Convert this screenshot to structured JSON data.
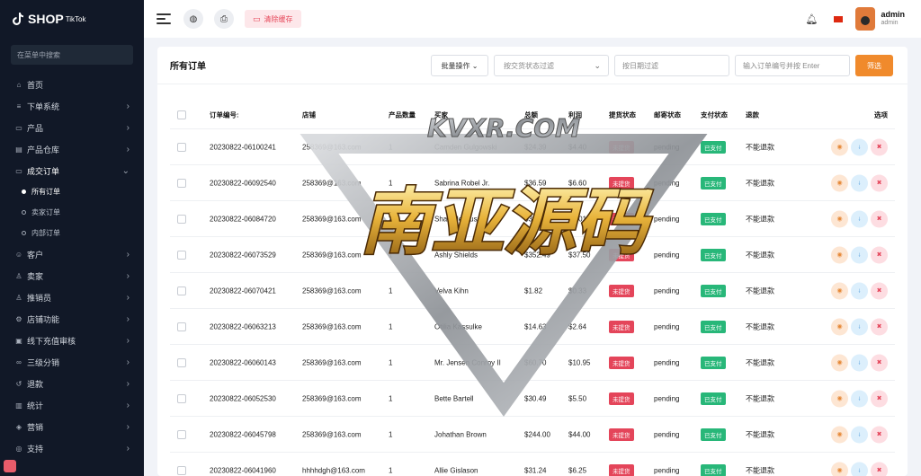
{
  "brand": {
    "name": "SHOP",
    "sub": "TikTok"
  },
  "sidebar": {
    "search_placeholder": "在菜单中搜索",
    "items": [
      {
        "label": "首页",
        "icon": "home-icon",
        "glyph": "⌂"
      },
      {
        "label": "下单系统",
        "icon": "list-icon",
        "glyph": "≡"
      },
      {
        "label": "产品",
        "icon": "bag-icon",
        "glyph": "▭"
      },
      {
        "label": "产品仓库",
        "icon": "warehouse-icon",
        "glyph": "▤"
      },
      {
        "label": "成交订单",
        "icon": "order-icon",
        "glyph": "▭"
      },
      {
        "label": "客户",
        "icon": "users-icon",
        "glyph": "☺"
      },
      {
        "label": "卖家",
        "icon": "seller-icon",
        "glyph": "♙"
      },
      {
        "label": "推销员",
        "icon": "promoter-icon",
        "glyph": "♙"
      },
      {
        "label": "店铺功能",
        "icon": "shop-icon",
        "glyph": "⚙"
      },
      {
        "label": "线下充值审核",
        "icon": "recharge-icon",
        "glyph": "▣"
      },
      {
        "label": "三级分销",
        "icon": "link-icon",
        "glyph": "∞"
      },
      {
        "label": "退款",
        "icon": "refund-icon",
        "glyph": "↺"
      },
      {
        "label": "统计",
        "icon": "chart-icon",
        "glyph": "▥"
      },
      {
        "label": "营销",
        "icon": "marketing-icon",
        "glyph": "◈"
      },
      {
        "label": "支持",
        "icon": "support-icon",
        "glyph": "◎"
      }
    ],
    "submenu": [
      {
        "label": "所有订单",
        "active": true
      },
      {
        "label": "卖家订单",
        "active": false
      },
      {
        "label": "内部订单",
        "active": false
      }
    ]
  },
  "topbar": {
    "clear_cache": "清除缓存",
    "user_name": "admin",
    "user_role": "admin"
  },
  "panel": {
    "title": "所有订单",
    "batch_label": "批量操作",
    "delivery_filter_placeholder": "按交货状态过滤",
    "date_placeholder": "按日期过滤",
    "search_placeholder": "输入订单编号并按 Enter",
    "filter_button": "筛选"
  },
  "table": {
    "headers": {
      "order_no": "订单编号:",
      "shop": "店铺",
      "qty": "产品数量",
      "buyer": "买家",
      "total": "总额",
      "profit": "利润",
      "pickup": "提货状态",
      "mail": "邮寄状态",
      "pay": "支付状态",
      "refund": "退款",
      "ops": "选项"
    },
    "rows": [
      {
        "order_no": "20230822-06100241",
        "shop": "258369@163.com",
        "qty": "1",
        "buyer": "Camden Gulgowski",
        "total": "$24.39",
        "profit": "$4.40",
        "pickup": "未提货",
        "mail": "pending",
        "pay": "已支付",
        "refund": "不能退款"
      },
      {
        "order_no": "20230822-06092540",
        "shop": "258369@163.com",
        "qty": "1",
        "buyer": "Sabrina Robel Jr.",
        "total": "$36.59",
        "profit": "$6.60",
        "pickup": "未提货",
        "mail": "pending",
        "pay": "已支付",
        "refund": "不能退款"
      },
      {
        "order_no": "20230822-06084720",
        "shop": "258369@163.com",
        "qty": "2",
        "buyer": "Shanelle Russel",
        "total": "$38.85",
        "profit": "$7.01",
        "pickup": "未提货",
        "mail": "pending",
        "pay": "已支付",
        "refund": "不能退款"
      },
      {
        "order_no": "20230822-06073529",
        "shop": "258369@163.com",
        "qty": "1",
        "buyer": "Ashly Shields",
        "total": "$352.49",
        "profit": "$37.50",
        "pickup": "未提货",
        "mail": "pending",
        "pay": "已支付",
        "refund": "不能退款"
      },
      {
        "order_no": "20230822-06070421",
        "shop": "258369@163.com",
        "qty": "1",
        "buyer": "Velva Kihn",
        "total": "$1.82",
        "profit": "$0.33",
        "pickup": "未提货",
        "mail": "pending",
        "pay": "已支付",
        "refund": "不能退款"
      },
      {
        "order_no": "20230822-06063213",
        "shop": "258369@163.com",
        "qty": "1",
        "buyer": "Otilia Kassulke",
        "total": "$14.63",
        "profit": "$2.64",
        "pickup": "未提货",
        "mail": "pending",
        "pay": "已支付",
        "refund": "不能退款"
      },
      {
        "order_no": "20230822-06060143",
        "shop": "258369@163.com",
        "qty": "1",
        "buyer": "Mr. Jensen Conroy II",
        "total": "$60.70",
        "profit": "$10.95",
        "pickup": "未提货",
        "mail": "pending",
        "pay": "已支付",
        "refund": "不能退款"
      },
      {
        "order_no": "20230822-06052530",
        "shop": "258369@163.com",
        "qty": "1",
        "buyer": "Bette Bartell",
        "total": "$30.49",
        "profit": "$5.50",
        "pickup": "未提货",
        "mail": "pending",
        "pay": "已支付",
        "refund": "不能退款"
      },
      {
        "order_no": "20230822-06045798",
        "shop": "258369@163.com",
        "qty": "1",
        "buyer": "Johathan Brown",
        "total": "$244.00",
        "profit": "$44.00",
        "pickup": "未提货",
        "mail": "pending",
        "pay": "已支付",
        "refund": "不能退款"
      },
      {
        "order_no": "20230822-06041960",
        "shop": "hhhhdgh@163.com",
        "qty": "1",
        "buyer": "Allie Gislason",
        "total": "$31.24",
        "profit": "$6.25",
        "pickup": "未提货",
        "mail": "pending",
        "pay": "已支付",
        "refund": "不能退款"
      }
    ]
  },
  "watermark": {
    "top_text": "KVXR.COM",
    "main_text": "南亚源码"
  },
  "colors": {
    "accent": "#f08a2c",
    "danger": "#e4455a",
    "success": "#28b779",
    "sidebar_bg": "#111827"
  }
}
